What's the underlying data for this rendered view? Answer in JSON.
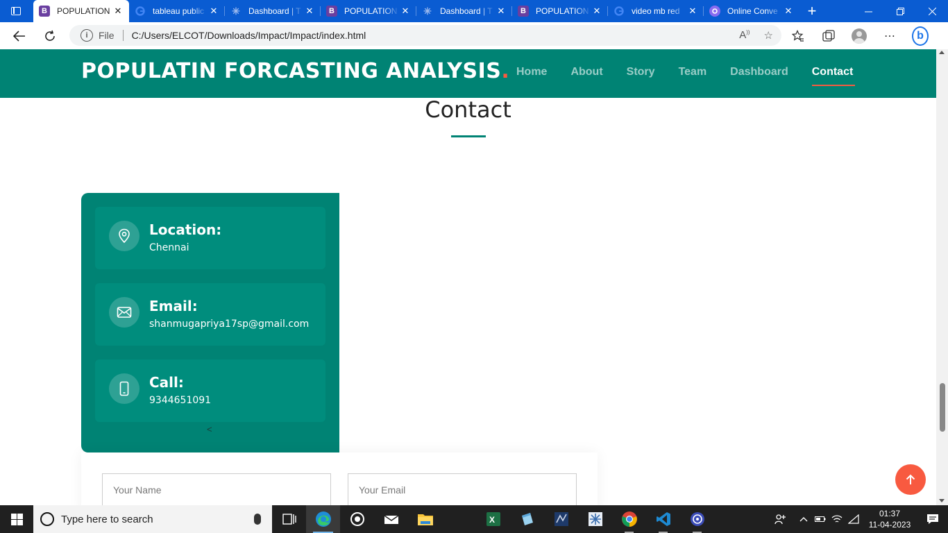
{
  "browser": {
    "tabs": [
      {
        "title": "POPULATION",
        "icon": "bootstrap-icon",
        "active": true
      },
      {
        "title": "tableau public",
        "icon": "google-icon",
        "active": false
      },
      {
        "title": "Dashboard | T",
        "icon": "tableau-icon",
        "active": false
      },
      {
        "title": "POPULATION",
        "icon": "bootstrap-icon",
        "active": false
      },
      {
        "title": "Dashboard | T",
        "icon": "tableau-icon",
        "active": false
      },
      {
        "title": "POPULATION",
        "icon": "bootstrap-icon",
        "active": false
      },
      {
        "title": "video mb red",
        "icon": "google-icon",
        "active": false
      },
      {
        "title": "Online Conve",
        "icon": "converter-icon",
        "active": false
      }
    ],
    "address": {
      "scheme_label": "File",
      "url": "C:/Users/ELCOT/Downloads/Impact/Impact/index.html"
    }
  },
  "site": {
    "logo": "POPULATIN FORCASTING ANALYSIS",
    "logo_dot": ".",
    "nav": [
      "Home",
      "About",
      "Story",
      "Team",
      "Dashboard",
      "Contact"
    ],
    "active_nav": "Contact"
  },
  "contact": {
    "title": "Contact",
    "items": [
      {
        "label": "Location:",
        "value": "Chennai",
        "icon": "map-pin-icon"
      },
      {
        "label": "Email:",
        "value": "shanmugapriya17sp@gmail.com",
        "icon": "envelope-icon"
      },
      {
        "label": "Call:",
        "value": "9344651091",
        "icon": "phone-icon"
      }
    ],
    "stray_char": "<",
    "form": {
      "name_placeholder": "Your Name",
      "email_placeholder": "Your Email"
    }
  },
  "taskbar": {
    "search_placeholder": "Type here to search",
    "time": "01:37",
    "date": "11-04-2023"
  },
  "colors": {
    "brand": "#008374",
    "accent": "#f85a40",
    "browser_chrome": "#0a5cd2"
  }
}
